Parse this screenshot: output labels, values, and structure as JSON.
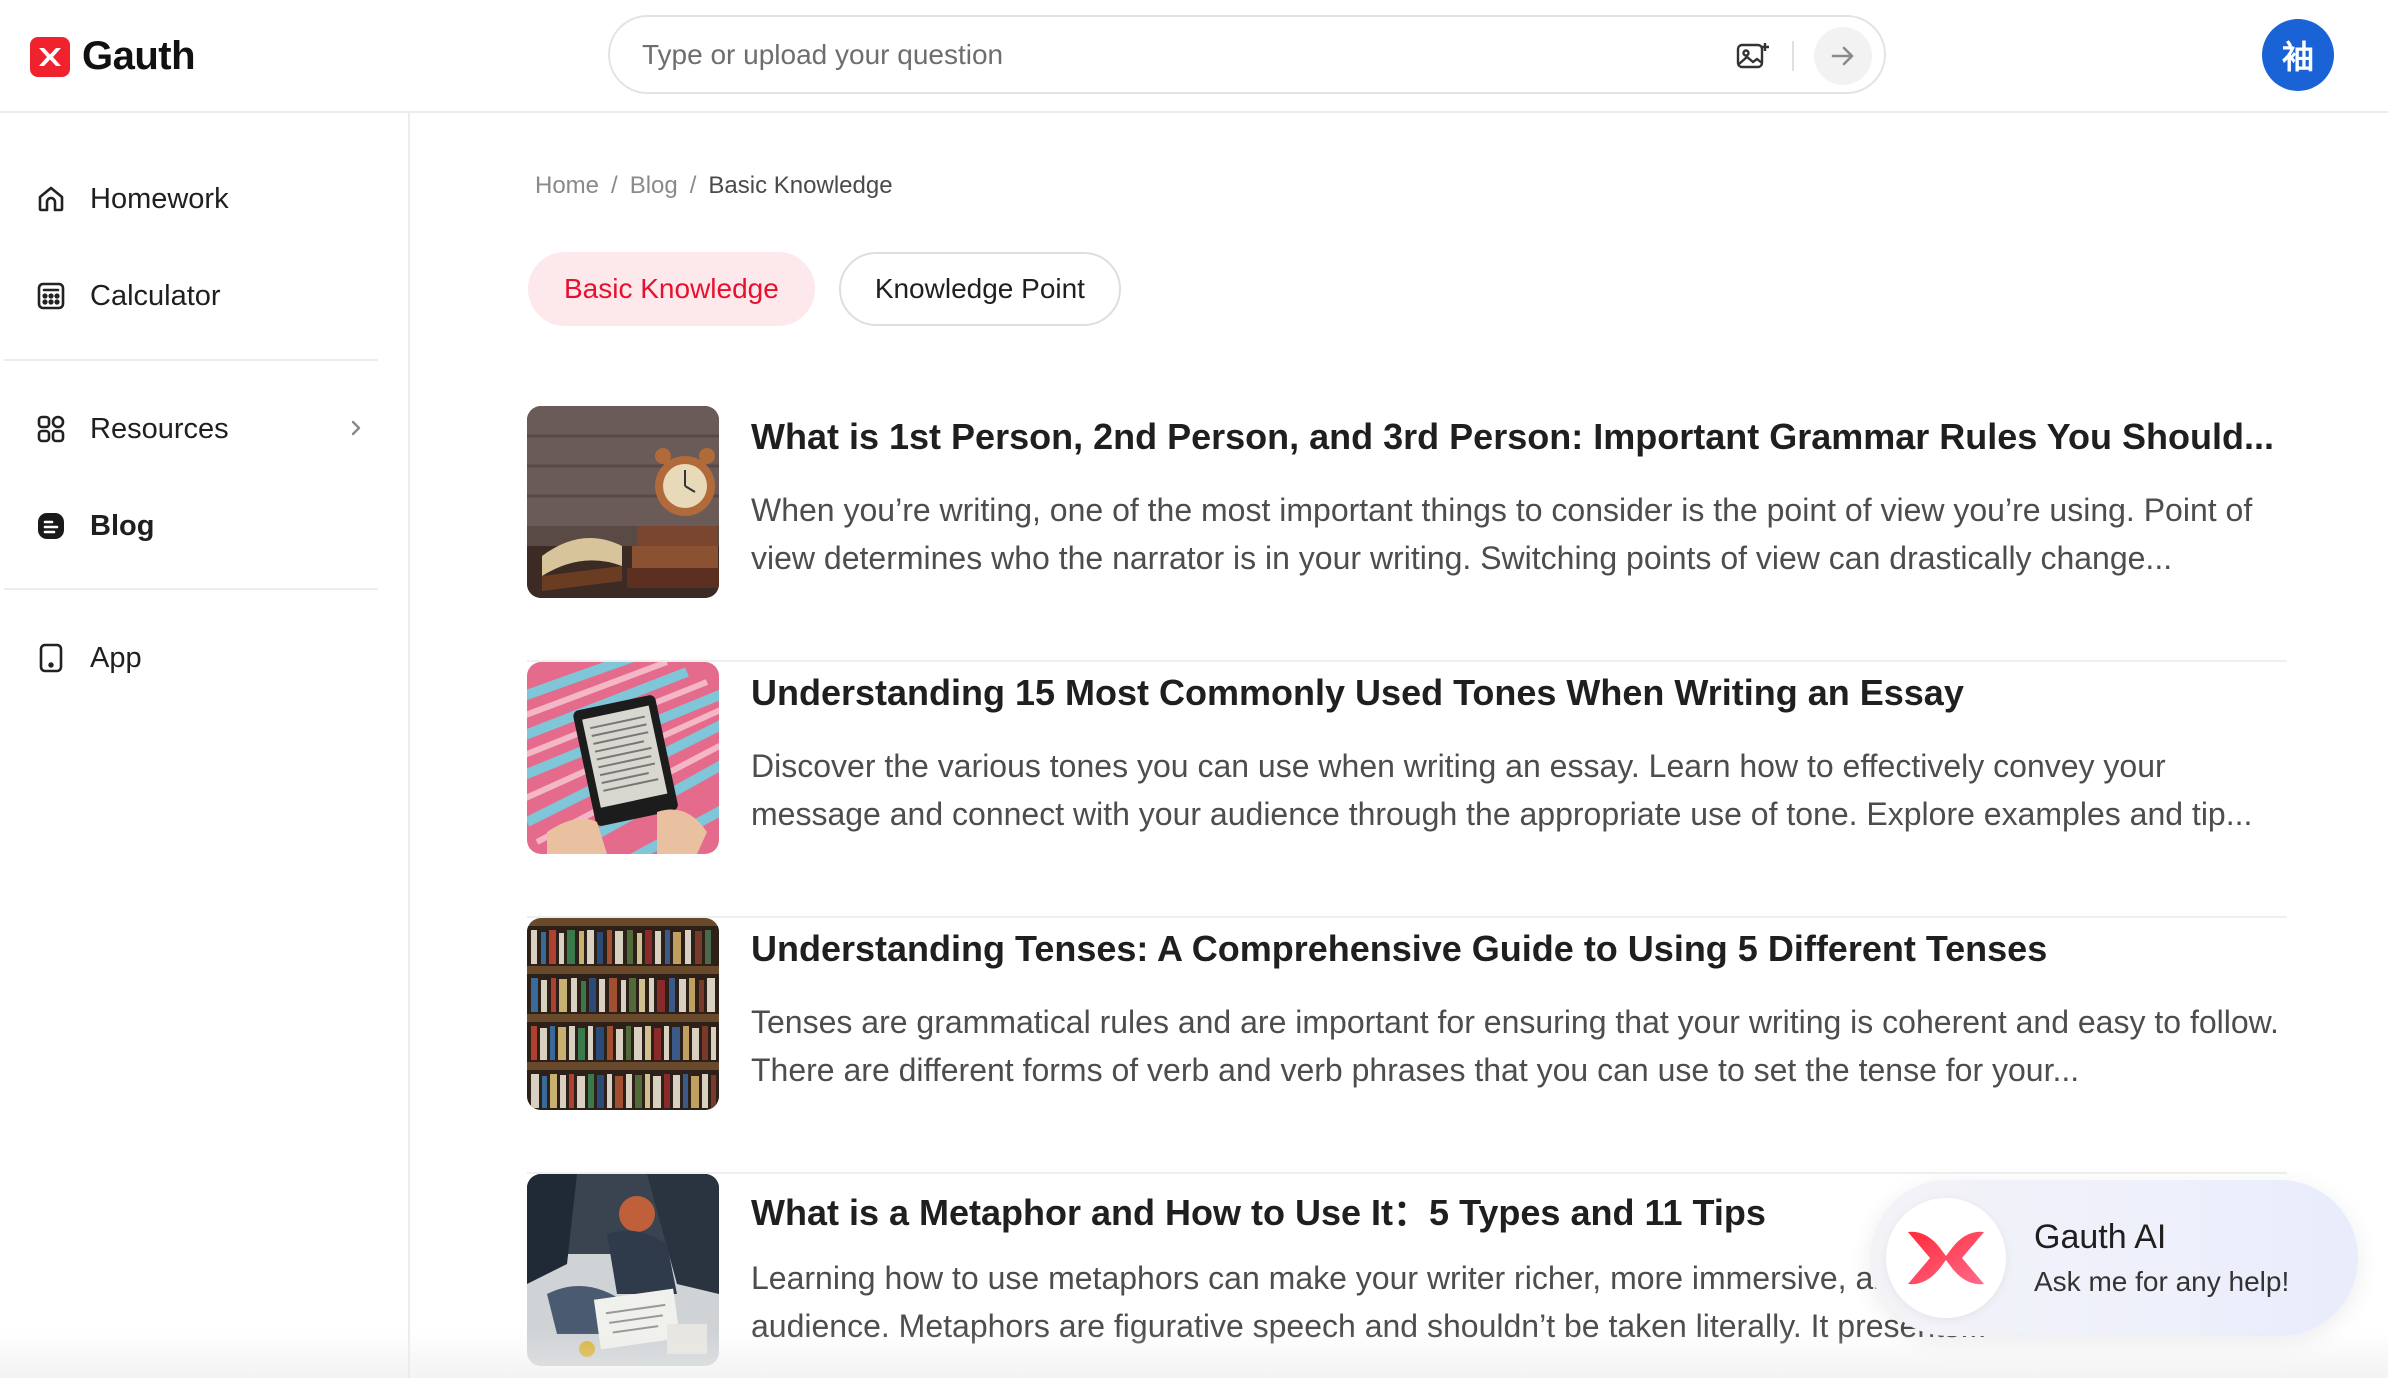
{
  "brand": {
    "name": "Gauth",
    "color": "#f0222e"
  },
  "search": {
    "placeholder": "Type or upload your question",
    "upload_icon": "image-upload-icon",
    "submit_icon": "arrow-right-icon"
  },
  "user": {
    "avatar_text": "袖",
    "avatar_color": "#1a63d6"
  },
  "sidebar": {
    "items": [
      {
        "label": "Homework",
        "icon": "home-icon"
      },
      {
        "label": "Calculator",
        "icon": "calculator-icon"
      },
      {
        "label": "Resources",
        "icon": "grid-icon",
        "has_submenu": true
      },
      {
        "label": "Blog",
        "icon": "blog-icon",
        "active": true
      },
      {
        "label": "App",
        "icon": "phone-icon"
      }
    ]
  },
  "breadcrumb": {
    "items": [
      "Home",
      "Blog",
      "Basic Knowledge"
    ],
    "separator": "/"
  },
  "tabs": [
    {
      "label": "Basic Knowledge",
      "active": true
    },
    {
      "label": "Knowledge Point",
      "active": false
    }
  ],
  "accent": {
    "active_tab_bg": "#fde9ec",
    "active_tab_text": "#e8112d"
  },
  "articles": [
    {
      "title": "What is 1st Person, 2nd Person, and 3rd Person: Important Grammar Rules You Should...",
      "description": "When you’re writing, one of the most important things to consider is the point of view you’re using. Point of view determines who the narrator is in your writing. Switching points of view can drastically change...",
      "thumb": "clock-and-books-image"
    },
    {
      "title": "Understanding 15 Most Commonly Used Tones When Writing an Essay",
      "description": "Discover the various tones you can use when writing an essay. Learn how to effectively convey your message and connect with your audience through the appropriate use of tone. Explore examples and tip...",
      "thumb": "ereader-hammock-image"
    },
    {
      "title": "Understanding Tenses: A Comprehensive Guide to Using 5 Different Tenses",
      "description": "Tenses are grammatical rules and are important for ensuring that your writing is coherent and easy to follow. There are different forms of verb and verb phrases that you can use to set the tense for your...",
      "thumb": "library-shelves-image"
    },
    {
      "title": "What is a Metaphor and How to Use It：5 Types and 11 Tips",
      "description": "Learning how to use metaphors can make your writer richer, more immersive, and more engaging for your audience. Metaphors are figurative speech and shouldn’t be taken literally. It presents...",
      "thumb": "students-studying-image"
    }
  ],
  "assistant": {
    "title": "Gauth AI",
    "subtitle": "Ask me for any help!"
  }
}
